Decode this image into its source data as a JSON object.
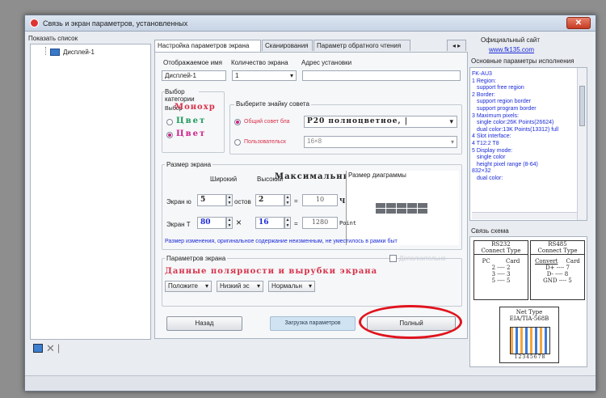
{
  "window": {
    "title": "Связь и экран параметров, установленных",
    "close_glyph": "✕"
  },
  "left": {
    "header": "Показать список",
    "tree_item": "Дисплей-1"
  },
  "tabs": [
    {
      "label": "Настройка параметров экрана"
    },
    {
      "label": "Сканирования"
    },
    {
      "label": "Параметр обратного чтения"
    }
  ],
  "tab_scroll": "◂ ▸",
  "fields": {
    "display_name_label": "Отображаемое имя",
    "display_name_value": "Дисплей-1",
    "screen_count_label": "Количество экрана",
    "screen_count_value": "1",
    "address_label": "Адрес установки"
  },
  "color_type": {
    "label": "Выбор категории",
    "mono_prefix": "Выбор",
    "mono_label": "Монохр",
    "color_label": "Цвет",
    "full_color_label": "Цвет"
  },
  "board": {
    "header": "Выберите знайку совета",
    "common_label": "Общий совет бла",
    "common_value": "P20 полноцветное, |",
    "user_label": "Пользовательск",
    "user_value": "16×8"
  },
  "screen_size": {
    "header": "Размер экрана",
    "width_label": "Широкий",
    "height_label": "Высокий",
    "max_label": "Максимальный",
    "chart_label": "Размер диаграммы",
    "row1_label": "Экран ю",
    "row1_w": "5",
    "row1_unit": "остов",
    "row1_h": "2",
    "row1_eq": "=",
    "row1_res": "10",
    "row1_suffix": "Ч",
    "row2_label": "Экран Т",
    "row2_w": "80",
    "row2_x": "×",
    "row2_h": "16",
    "row2_eq": "=",
    "row2_res": "1280",
    "row2_suffix": "Point",
    "note": "Размер изменения, оригинальное содержание неизменным, не уместилось в рамки быт"
  },
  "params": {
    "header": "Параметров экрана",
    "checkbox_label": "Дополнительно",
    "polarity_title": "Данные полярности и вырубки экрана",
    "dropdowns": [
      "Положите",
      "Низкий эс",
      "Нормальн"
    ]
  },
  "buttons": {
    "back": "Назад",
    "load": "Загрузка параметров",
    "finish": "Полный"
  },
  "right": {
    "site_label": "Официальный сайт",
    "site_url": "www.fk135.com",
    "info_header": "Основные параметры исполнения",
    "info_lines": [
      "FK-AU3",
      "1 Region:",
      "support free region",
      "2 Border:",
      "support region border",
      "support program border",
      "3 Maximum pixels:",
      "single color:26K Points(26624)",
      "dual color:13K Points(13312) full",
      "4 Slot interface:",
      "4 T12:2 T8",
      "5 Display mode:",
      "single color",
      "height pixel range (8-64)",
      "832×32",
      "dual color:"
    ],
    "conn_header": "Связь схема",
    "rs232_title": "RS232",
    "rs232_sub": "Connect Type",
    "rs232_cols": [
      "PC",
      "Card"
    ],
    "rs232_rows": [
      "2 ---- 2",
      "3 ---- 3",
      "5 ---- 5"
    ],
    "rs485_title": "RS485",
    "rs485_sub": "Connect Type",
    "rs485_cols": [
      "Convert",
      "Card"
    ],
    "rs485_rows": [
      "D+ ---- 7",
      "D- ---- 8",
      "GND ---- 5"
    ],
    "net_title": "Net Type",
    "net_sub": "EIA/TIA-568B",
    "net_pins": "12345678"
  },
  "colors": {
    "accent": "#1b2bd8",
    "highlight": "#e0141e",
    "red_text": "#d8324a"
  }
}
